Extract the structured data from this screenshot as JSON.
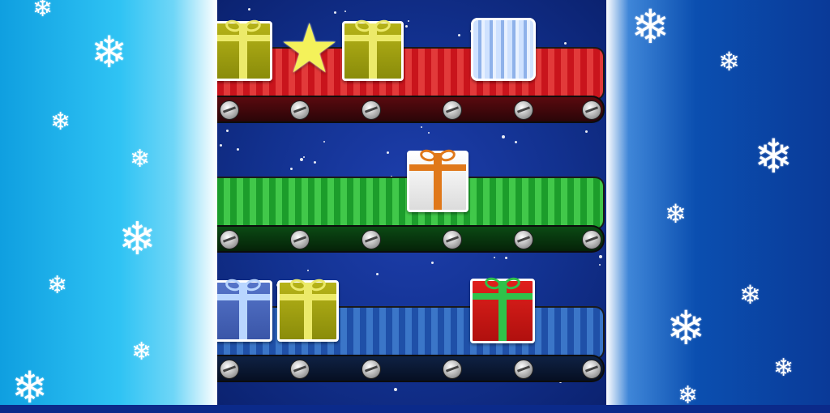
{
  "scene": {
    "name": "gift-conveyor-game",
    "palette": {
      "left_panel": "#2fc3f4",
      "right_panel": "#0b4fb0",
      "play_area": "#12318f",
      "belt_red": "#c9141c",
      "belt_green": "#1c9d2b",
      "belt_blue": "#1f50a8"
    }
  },
  "decorations": {
    "snowflake_glyph": "❄"
  },
  "conveyors": [
    {
      "color": "red",
      "items": [
        "olive-gift",
        "star",
        "olive-gift",
        "ice-block"
      ]
    },
    {
      "color": "green",
      "items": [
        "white-gift"
      ]
    },
    {
      "color": "blue",
      "items": [
        "blue-gift",
        "olive-gift",
        "red-gift"
      ]
    }
  ],
  "icons": {
    "star": "★"
  }
}
